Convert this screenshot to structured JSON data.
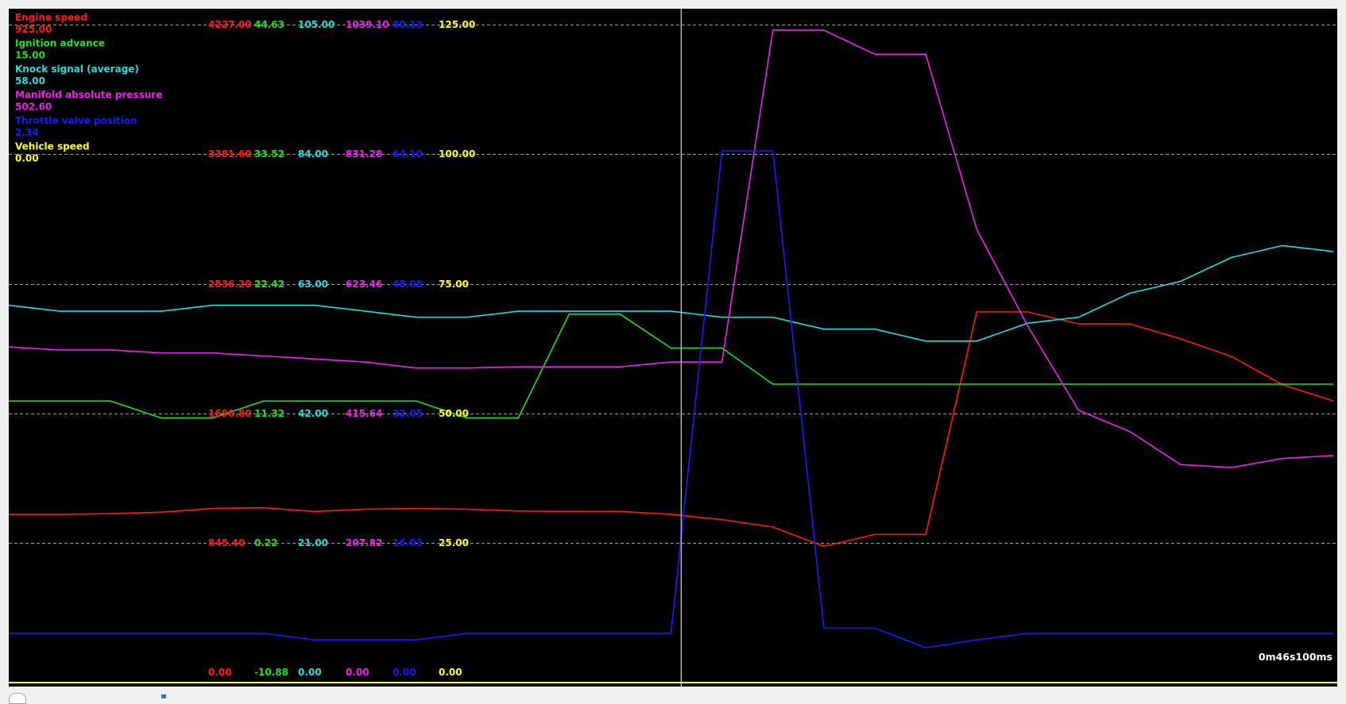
{
  "chart_data": {
    "type": "line",
    "time_label": "0m46s100ms",
    "series": [
      {
        "name": "Engine speed",
        "current_value": "925.00",
        "color": "#ff1a1a",
        "ticks": [
          "0.00",
          "845.40",
          "1690.80",
          "2536.20",
          "3381.60",
          "4227.00"
        ],
        "x": [
          0,
          1,
          2,
          3,
          4,
          5,
          6,
          7,
          8,
          9,
          10,
          11,
          12,
          13,
          14,
          15,
          16,
          17,
          18,
          19,
          20,
          21,
          22,
          23,
          24,
          25,
          26
        ],
        "y": [
          925,
          925,
          930,
          940,
          965,
          970,
          945,
          960,
          965,
          960,
          948,
          945,
          945,
          925,
          890,
          840,
          710,
          790,
          790,
          2290,
          2290,
          2210,
          2210,
          2110,
          1990,
          1800,
          1690
        ]
      },
      {
        "name": "Ignition advance",
        "current_value": "15.00",
        "color": "#22e022",
        "ticks": [
          "-10.88",
          "0.22",
          "11.32",
          "22.42",
          "33.52",
          "44.63"
        ],
        "x": [
          0,
          1,
          2,
          3,
          4,
          5,
          6,
          7,
          8,
          9,
          10,
          11,
          12,
          13,
          14,
          15,
          16,
          17,
          18,
          19,
          20,
          21,
          22,
          23,
          24,
          25,
          26
        ],
        "y": [
          11.3,
          11.3,
          11.3,
          9.8,
          9.8,
          11.3,
          11.3,
          11.3,
          11.3,
          9.8,
          9.8,
          19.0,
          19.0,
          16.0,
          16.0,
          12.8,
          12.8,
          12.8,
          12.8,
          12.8,
          12.8,
          12.8,
          12.8,
          12.8,
          12.8,
          12.8,
          12.8
        ]
      },
      {
        "name": "Knock signal (average)",
        "current_value": "58.00",
        "color": "#22dddd",
        "ticks": [
          "0.00",
          "21.00",
          "42.00",
          "63.00",
          "84.00",
          "105.00"
        ],
        "x": [
          0,
          1,
          2,
          3,
          4,
          5,
          6,
          7,
          8,
          9,
          10,
          11,
          12,
          13,
          14,
          15,
          16,
          17,
          18,
          19,
          20,
          21,
          22,
          23,
          24,
          25,
          26
        ],
        "y": [
          58,
          57,
          57,
          57,
          58,
          58,
          58,
          57,
          56,
          56,
          57,
          57,
          57,
          57,
          56,
          56,
          54,
          54,
          52,
          52,
          55,
          56,
          60,
          62,
          66,
          68,
          67
        ]
      },
      {
        "name": "Manifold absolute pressure",
        "current_value": "502.60",
        "color": "#ee22ee",
        "ticks": [
          "0.00",
          "207.82",
          "415.64",
          "623.46",
          "831.28",
          "1039.10"
        ],
        "x": [
          0,
          1,
          2,
          3,
          4,
          5,
          6,
          7,
          8,
          9,
          10,
          11,
          12,
          13,
          14,
          15,
          16,
          17,
          18,
          19,
          20,
          21,
          22,
          23,
          24,
          25,
          26
        ],
        "y": [
          505,
          500,
          500,
          495,
          495,
          490,
          485,
          480,
          470,
          470,
          472,
          472,
          472,
          480,
          480,
          1030,
          1030,
          990,
          990,
          700,
          540,
          400,
          365,
          310,
          305,
          320,
          325
        ]
      },
      {
        "name": "Throttle valve position",
        "current_value": "2.34",
        "color": "#1a1aff",
        "ticks": [
          "0.00",
          "16.03",
          "32.05",
          "48.08",
          "64.10",
          "80.13"
        ],
        "x": [
          0,
          1,
          2,
          3,
          4,
          5,
          6,
          7,
          8,
          9,
          10,
          11,
          12,
          13,
          14,
          15,
          16,
          17,
          18,
          19,
          20,
          21,
          22,
          23,
          24,
          25,
          26
        ],
        "y": [
          2.34,
          2.34,
          2.34,
          2.34,
          2.34,
          2.34,
          1.5,
          1.5,
          1.5,
          2.34,
          2.34,
          2.34,
          2.34,
          2.34,
          64.0,
          64.0,
          3.0,
          3.0,
          0.5,
          1.5,
          2.34,
          2.34,
          2.34,
          2.34,
          2.34,
          2.34,
          2.34
        ]
      },
      {
        "name": "Vehicle speed",
        "current_value": "0.00",
        "color": "#ffff22",
        "ticks": [
          "0.00",
          "25.00",
          "50.00",
          "75.00",
          "100.00",
          "125.00"
        ],
        "x": [
          0,
          1,
          2,
          3,
          4,
          5,
          6,
          7,
          8,
          9,
          10,
          11,
          12,
          13,
          14,
          15,
          16,
          17,
          18,
          19,
          20,
          21,
          22,
          23,
          24,
          25,
          26
        ],
        "y": [
          0,
          0,
          0,
          0,
          0,
          0,
          0,
          0,
          0,
          0,
          0,
          0,
          0,
          0,
          0,
          0,
          0,
          0,
          0,
          0,
          0,
          0,
          0,
          0,
          0,
          0,
          0
        ]
      }
    ],
    "cursor_x": 13.2,
    "grid": true
  }
}
